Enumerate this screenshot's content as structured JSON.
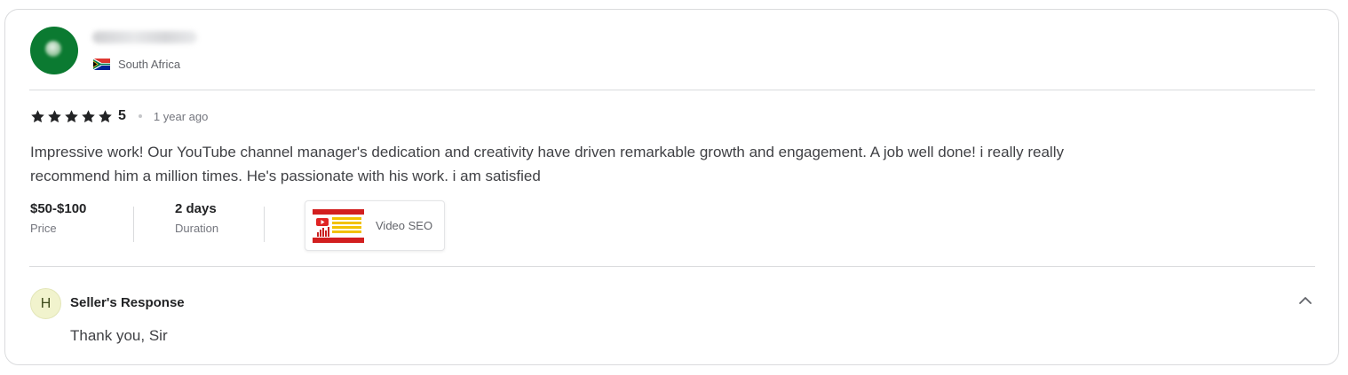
{
  "reviewer": {
    "country": "South Africa",
    "flag_icon": "south-africa-flag-icon"
  },
  "review": {
    "rating": 5,
    "rating_label": "5",
    "time_ago": "1 year ago",
    "text": "Impressive work! Our YouTube channel manager's dedication and creativity have driven remarkable growth and engagement. A job well done! i really really recommend him a million times. He's passionate with his work. i am satisfied"
  },
  "meta": {
    "price_value": "$50-$100",
    "price_label": "Price",
    "duration_value": "2 days",
    "duration_label": "Duration"
  },
  "gig": {
    "title": "Video SEO"
  },
  "seller_response": {
    "avatar_letter": "H",
    "title": "Seller's Response",
    "text": "Thank you, Sir"
  },
  "colors": {
    "avatar_bg": "#0b7a31",
    "star": "#222325",
    "seller_avatar_bg": "#f1f3cd"
  }
}
